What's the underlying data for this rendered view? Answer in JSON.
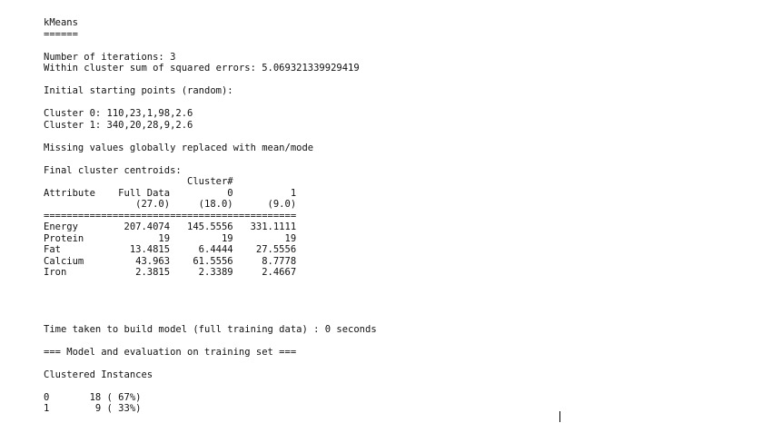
{
  "output": {
    "text": "kMeans\n======\n\nNumber of iterations: 3\nWithin cluster sum of squared errors: 5.069321339929419\n\nInitial starting points (random):\n\nCluster 0: 110,23,1,98,2.6\nCluster 1: 340,20,28,9,2.6\n\nMissing values globally replaced with mean/mode\n\nFinal cluster centroids:\n                         Cluster#\nAttribute    Full Data          0          1\n                (27.0)     (18.0)      (9.0)\n============================================\nEnergy        207.4074   145.5556   331.1111\nProtein             19         19         19\nFat            13.4815     6.4444    27.5556\nCalcium         43.963    61.5556     8.7778\nIron            2.3815     2.3389     2.4667\n\n\n\n\nTime taken to build model (full training data) : 0 seconds\n\n=== Model and evaluation on training set ===\n\nClustered Instances\n\n0       18 ( 67%)\n1        9 ( 33%)"
  }
}
